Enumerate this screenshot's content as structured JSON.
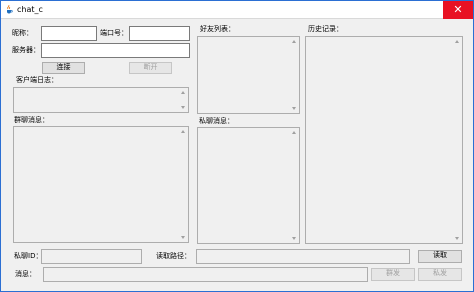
{
  "window": {
    "title": "chat_c",
    "close_glyph": "✕",
    "accent": "#2b6fd3",
    "close_color": "#e81123"
  },
  "connection": {
    "nickname_label": "昵称：",
    "nickname_value": "",
    "port_label": "端口号：",
    "port_value": "",
    "server_label": "服务器：",
    "server_value": "",
    "connect_label": "连接",
    "disconnect_label": "断开"
  },
  "client_log": {
    "label": "客户端日志："
  },
  "group_messages": {
    "label": "群聊消息："
  },
  "friend_list": {
    "label": "好友列表："
  },
  "private_messages": {
    "label": "私聊消息："
  },
  "history": {
    "label": "历史记录："
  },
  "bottom": {
    "private_id_label": "私聊ID：",
    "read_path_label": "读取路径：",
    "read_button_label": "读取",
    "message_label": "消息：",
    "group_send_label": "群发",
    "private_send_label": "私发"
  },
  "icons": {
    "app": "java-cup-icon",
    "close": "close-icon",
    "scroll_up": "scroll-up-arrow-icon",
    "scroll_down": "scroll-down-arrow-icon"
  }
}
